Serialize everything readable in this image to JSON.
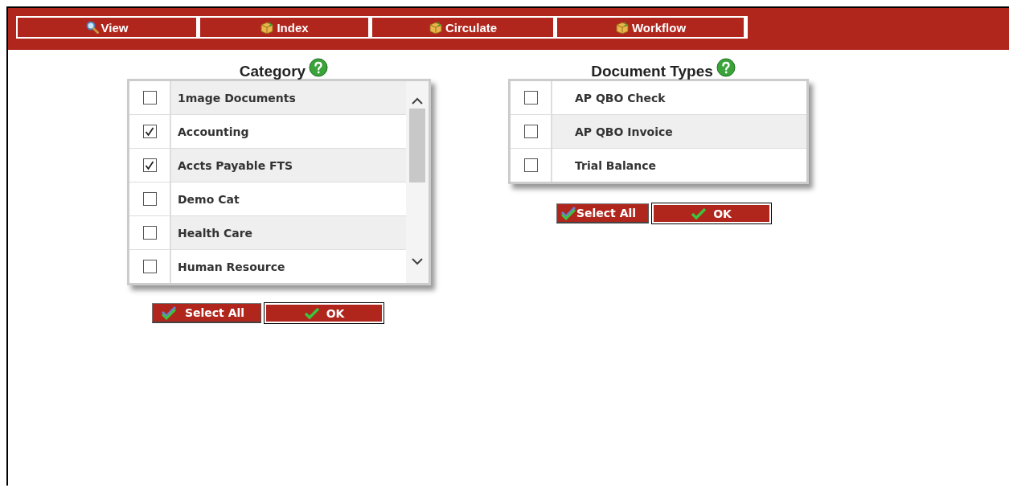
{
  "nav": [
    {
      "label": "View",
      "kind": "search"
    },
    {
      "label": "Index",
      "kind": "box"
    },
    {
      "label": "Circulate",
      "kind": "box"
    },
    {
      "label": "Workflow",
      "kind": "box"
    }
  ],
  "category": {
    "title": "Category",
    "items": [
      {
        "label": "1mage Documents",
        "checked": false
      },
      {
        "label": "Accounting",
        "checked": true
      },
      {
        "label": "Accts Payable FTS",
        "checked": true
      },
      {
        "label": "Demo Cat",
        "checked": false
      },
      {
        "label": "Health Care",
        "checked": false
      },
      {
        "label": "Human Resource",
        "checked": false
      }
    ],
    "buttons": [
      {
        "label": "Select All",
        "kind": "select-all"
      },
      {
        "label": "OK",
        "kind": "ok"
      }
    ]
  },
  "document_types": {
    "title": "Document Types",
    "items": [
      {
        "label": "AP QBO Check",
        "checked": false
      },
      {
        "label": "AP QBO Invoice",
        "checked": false
      },
      {
        "label": "Trial Balance",
        "checked": false
      }
    ],
    "buttons": [
      {
        "label": "Select All",
        "kind": "select-all"
      },
      {
        "label": "OK",
        "kind": "ok"
      }
    ]
  }
}
